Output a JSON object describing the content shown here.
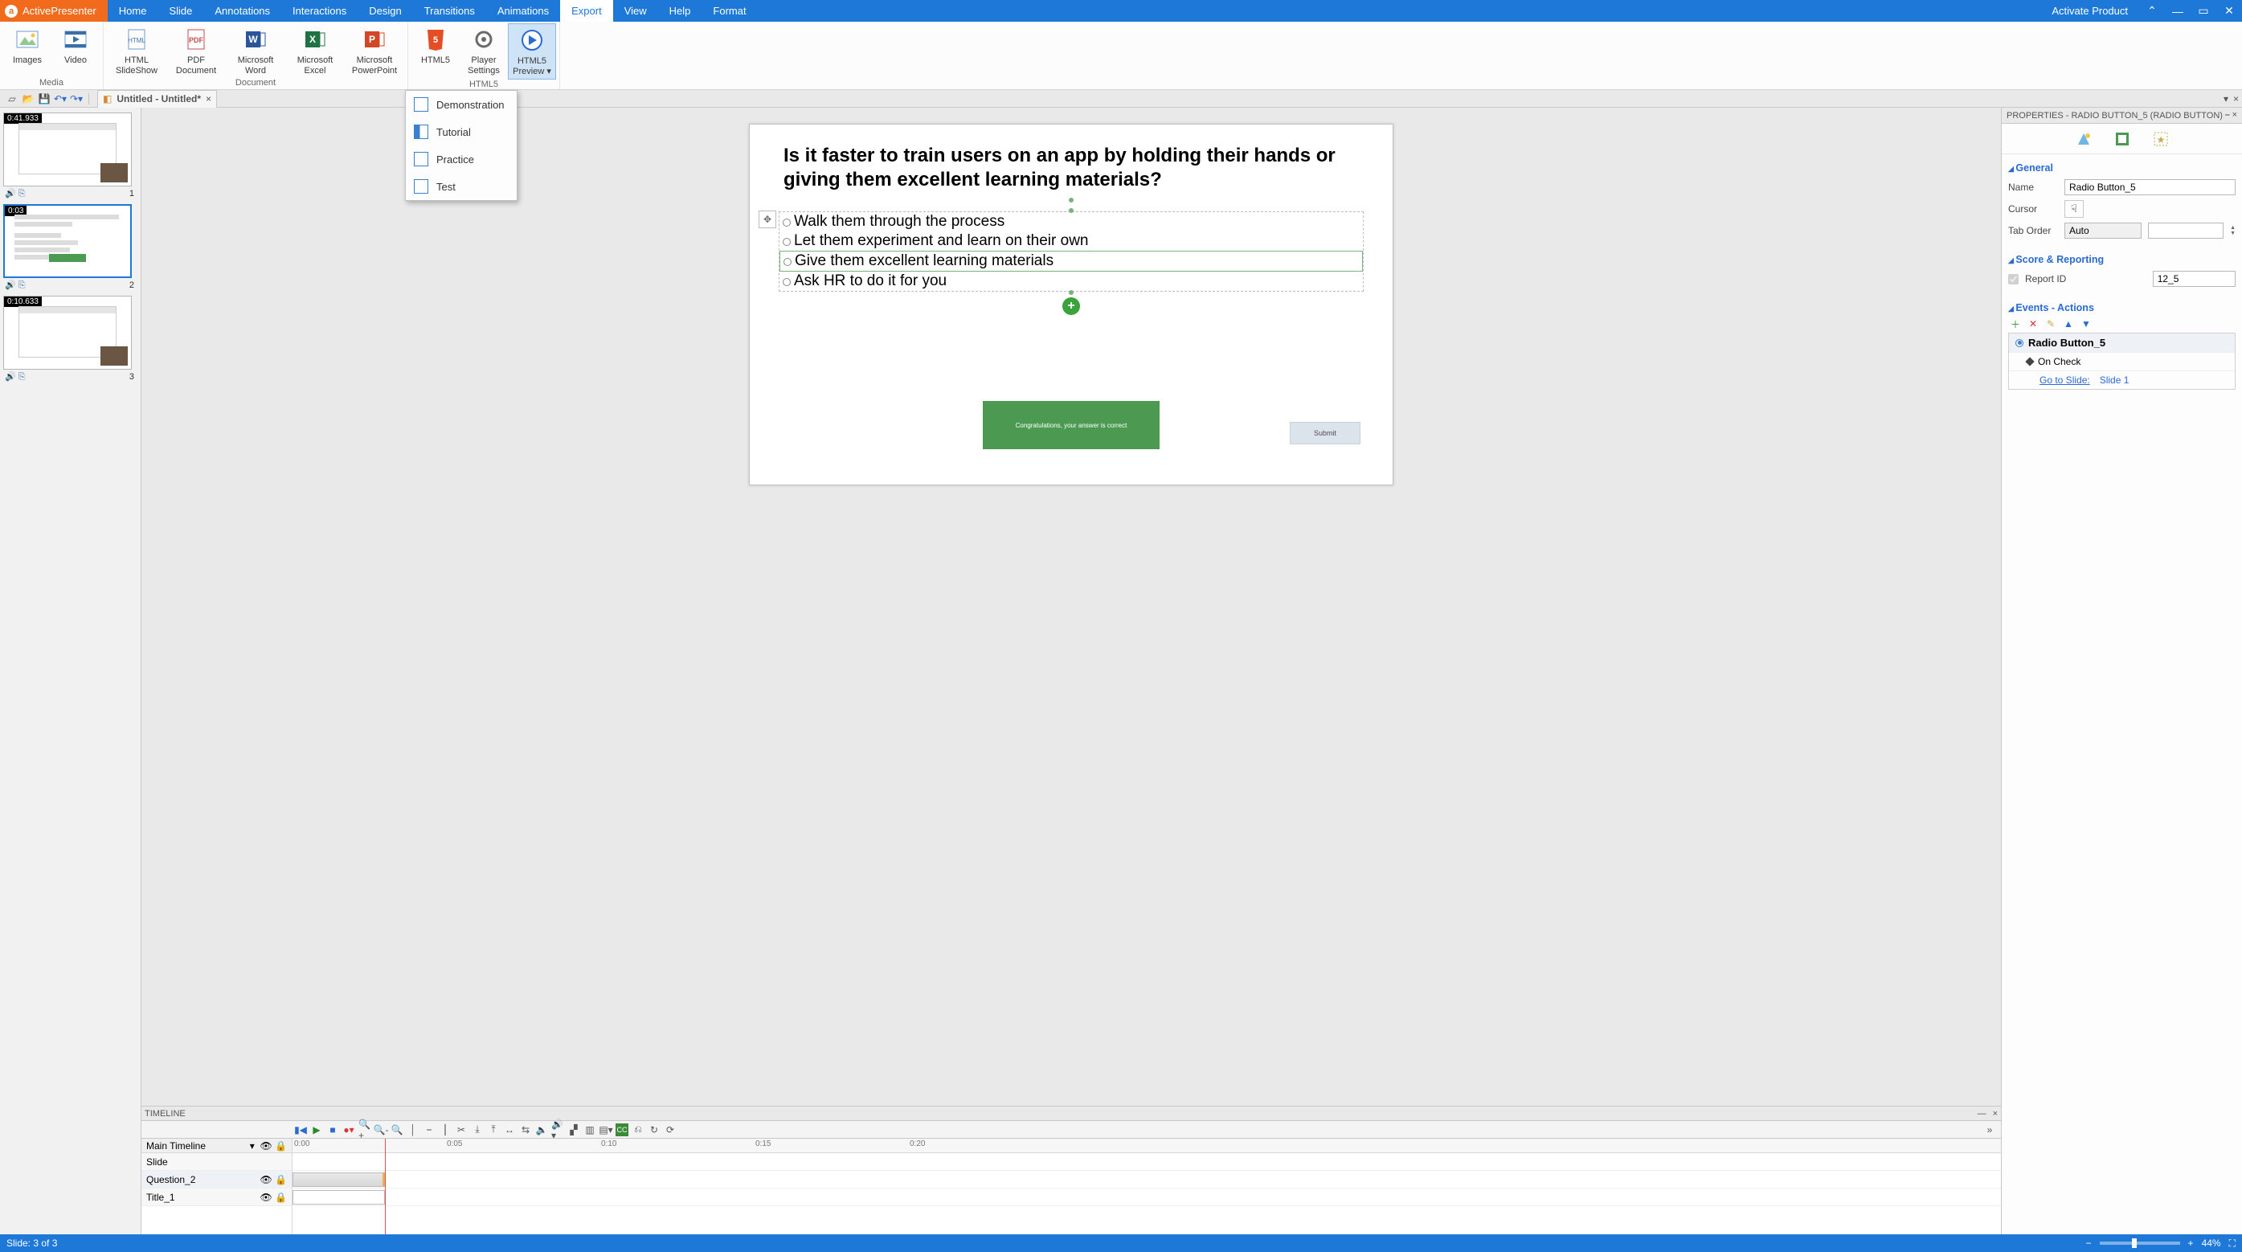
{
  "app": {
    "name": "ActivePresenter"
  },
  "menu": {
    "items": [
      "Home",
      "Slide",
      "Annotations",
      "Interactions",
      "Design",
      "Transitions",
      "Animations",
      "Export",
      "View",
      "Help",
      "Format"
    ],
    "active": "Export",
    "activate": "Activate Product"
  },
  "ribbon": {
    "groups": [
      {
        "name": "Media",
        "buttons": [
          {
            "id": "images",
            "label": "Images"
          },
          {
            "id": "video",
            "label": "Video"
          }
        ]
      },
      {
        "name": "Document",
        "buttons": [
          {
            "id": "html-slideshow",
            "label": "HTML\nSlideShow"
          },
          {
            "id": "pdf",
            "label": "PDF\nDocument"
          },
          {
            "id": "word",
            "label": "Microsoft\nWord"
          },
          {
            "id": "excel",
            "label": "Microsoft\nExcel"
          },
          {
            "id": "ppt",
            "label": "Microsoft\nPowerPoint"
          }
        ]
      },
      {
        "name": "HTML5",
        "buttons": [
          {
            "id": "html5",
            "label": "HTML5"
          },
          {
            "id": "player",
            "label": "Player\nSettings"
          },
          {
            "id": "preview",
            "label": "HTML5\nPreview ▾",
            "selected": true
          }
        ]
      }
    ],
    "dropdown": [
      "Demonstration",
      "Tutorial",
      "Practice",
      "Test"
    ]
  },
  "docstrip": {
    "title": "Untitled - Untitled*"
  },
  "thumbs": [
    {
      "badge": "0:41.933",
      "idx": "1"
    },
    {
      "badge": "0:03",
      "idx": "2",
      "selected": true
    },
    {
      "badge": "0:10.633",
      "idx": "3"
    }
  ],
  "slide": {
    "question": "Is it faster to train users on an app by holding their hands or giving them excellent learning materials?",
    "answers": [
      "Walk them through the process",
      "Let them experiment and learn on their own",
      "Give them excellent learning materials",
      "Ask HR to do it for you"
    ],
    "selectedAnswerIndex": 2,
    "congrats": "Congratulations, your answer is correct",
    "submit": "Submit"
  },
  "timeline": {
    "title": "TIMELINE",
    "track": "Main Timeline",
    "rows": [
      "Slide",
      "Question_2",
      "Title_1"
    ],
    "ticks": [
      "0:00",
      "0:05",
      "0:10",
      "0:15",
      "0:20"
    ]
  },
  "props": {
    "title": "PROPERTIES - RADIO BUTTON_5 (RADIO BUTTON)",
    "general": {
      "hdr": "General",
      "name_label": "Name",
      "name": "Radio Button_5",
      "cursor_label": "Cursor",
      "taborder_label": "Tab Order",
      "taborder": "Auto",
      "taborder_num": ""
    },
    "score": {
      "hdr": "Score & Reporting",
      "report_label": "Report ID",
      "report": "12_5"
    },
    "events": {
      "hdr": "Events - Actions",
      "root": "Radio Button_5",
      "trigger": "On Check",
      "action": "Go to Slide:",
      "target": "Slide 1"
    }
  },
  "status": {
    "text": "Slide: 3 of 3",
    "zoom": "44%"
  }
}
